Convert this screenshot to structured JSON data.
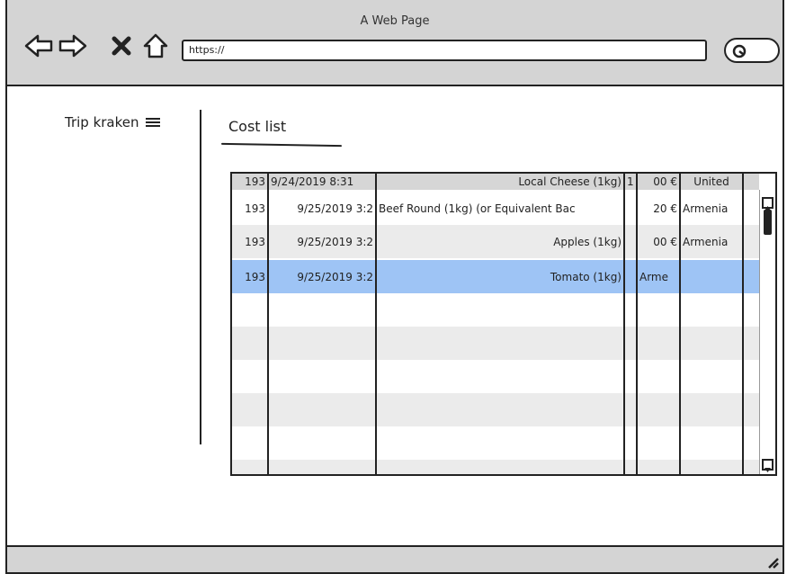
{
  "window": {
    "title": "A Web Page"
  },
  "toolbar": {
    "url_value": "https://"
  },
  "sidebar": {
    "brand": "Trip kraken"
  },
  "main": {
    "title": "Cost list"
  },
  "table": {
    "rows": [
      [
        "193",
        "9/24/2019 8:31",
        "Local Cheese (1kg)",
        "1",
        "00 €",
        "United"
      ],
      [
        "193",
        "9/25/2019 3:2",
        "Beef Round (1kg) (or Equivalent Bac",
        "",
        "20 €",
        "Armenia"
      ],
      [
        "193",
        "9/25/2019 3:2",
        "Apples (1kg)",
        "",
        "00 €",
        "Armenia"
      ],
      [
        "193",
        "9/25/2019 3:2",
        "Tomato (1kg)",
        "",
        "Arme",
        ""
      ]
    ]
  },
  "colors": {
    "selected_row": "#9ec4f5",
    "chrome": "#d4d4d4",
    "header_row": "#d6d6d6"
  }
}
